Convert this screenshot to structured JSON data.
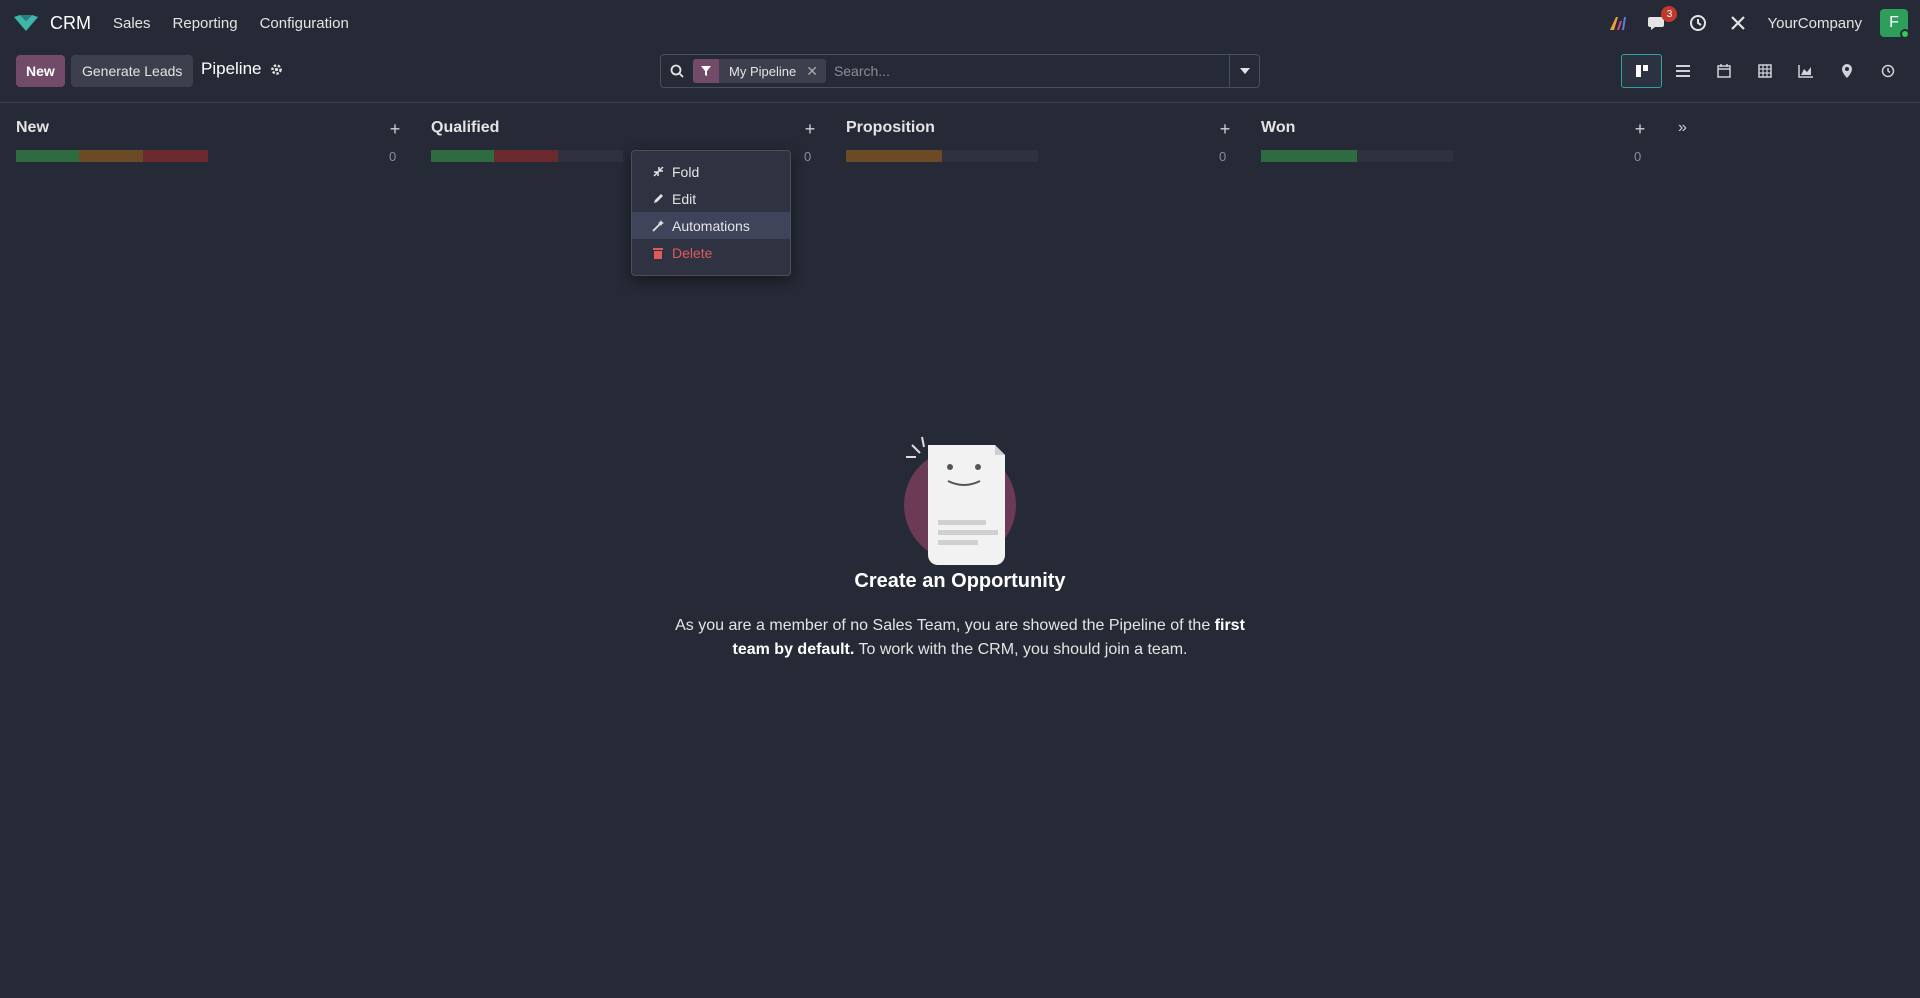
{
  "navbar": {
    "app_name": "CRM",
    "menu": [
      "Sales",
      "Reporting",
      "Configuration"
    ],
    "chat_badge": "3",
    "company": "YourCompany",
    "avatar_letter": "F"
  },
  "control": {
    "new_label": "New",
    "generate_label": "Generate Leads",
    "breadcrumb": "Pipeline",
    "facet_label": "My Pipeline",
    "search_placeholder": "Search..."
  },
  "columns": [
    {
      "title": "New",
      "count": "0",
      "bar": {
        "green": 0.33,
        "orange": 0.33,
        "red": 0.34
      }
    },
    {
      "title": "Qualified",
      "count": "0",
      "bar": {
        "green": 0.33,
        "orange": 0.0,
        "red": 0.33
      }
    },
    {
      "title": "Proposition",
      "count": "0",
      "bar": {
        "green": 0.0,
        "orange": 0.5,
        "red": 0.0
      }
    },
    {
      "title": "Won",
      "count": "0",
      "bar": {
        "green": 0.5,
        "orange": 0.0,
        "red": 0.0
      }
    }
  ],
  "dropdown": {
    "items": [
      "Fold",
      "Edit",
      "Automations",
      "Delete"
    ]
  },
  "empty": {
    "title": "Create an Opportunity",
    "text_1": "As you are a member of no Sales Team, you are showed the Pipeline of the ",
    "text_bold": "first team by default.",
    "text_2": " To work with the CRM, you should join a team."
  },
  "colors": {
    "brand": "#714b67",
    "background": "#262a36",
    "danger": "#e05a5a",
    "active_view": "#2ea3a0"
  }
}
